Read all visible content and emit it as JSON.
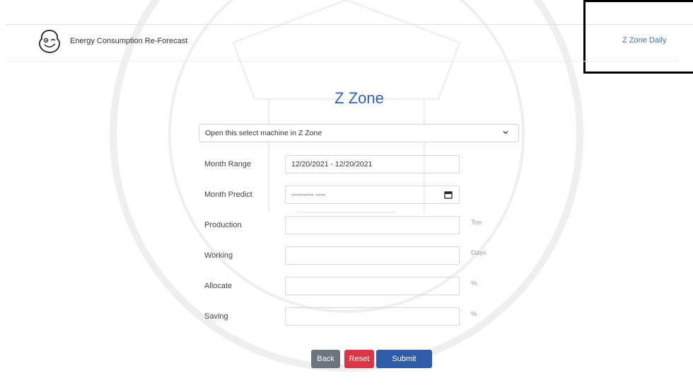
{
  "brand": {
    "name": "Energy Consumption Re-Forecast"
  },
  "nav": {
    "link_label": "Z Zone Daily"
  },
  "page": {
    "title": "Z Zone"
  },
  "machine_select": {
    "value": "Open this select machine in Z Zone"
  },
  "form": {
    "month_range": {
      "label": "Month Range",
      "value": "12/20/2021 - 12/20/2021"
    },
    "month_predict": {
      "label": "Month Predict",
      "value": "--------- ----"
    },
    "production": {
      "label": "Production",
      "unit": "Ton",
      "value": ""
    },
    "working": {
      "label": "Working",
      "unit": "Days",
      "value": ""
    },
    "allocate": {
      "label": "Allocate",
      "unit": "%",
      "value": ""
    },
    "saving": {
      "label": "Saving",
      "unit": "%",
      "value": ""
    }
  },
  "buttons": {
    "back": "Back",
    "reset": "Reset",
    "submit": "Submit"
  },
  "colors": {
    "title": "#3160b8",
    "link": "#3b6fd4",
    "back": "#6c757d",
    "reset": "#dc3545",
    "submit": "#2e5ca8"
  }
}
